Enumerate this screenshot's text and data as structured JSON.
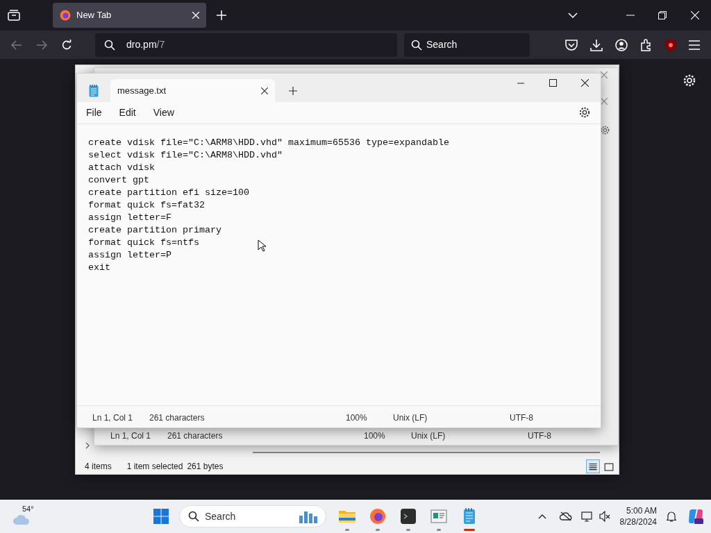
{
  "browser": {
    "tabs": [
      {
        "title": "New Tab",
        "selected": true
      }
    ],
    "address": {
      "host": "dro.pm",
      "path": "/7"
    },
    "search": {
      "placeholder": "Search"
    }
  },
  "explorer_window": {
    "status": {
      "items": "4 items",
      "selection": "1 item selected",
      "size": "261 bytes"
    },
    "view_buttons": [
      {
        "kind": "details",
        "selected": true
      },
      {
        "kind": "tiles",
        "selected": false
      }
    ]
  },
  "back_notepad": {
    "status": {
      "position": "Ln 1, Col 1",
      "characters": "261 characters",
      "zoom": "100%",
      "line_ending": "Unix (LF)",
      "encoding": "UTF-8"
    }
  },
  "notepad": {
    "tabs": [
      {
        "title": "message.txt",
        "selected": true
      }
    ],
    "menu": [
      "File",
      "Edit",
      "View"
    ],
    "lines": [
      "create vdisk file=\"C:\\ARM8\\HDD.vhd\" maximum=65536 type=expandable",
      "select vdisk file=\"C:\\ARM8\\HDD.vhd\"",
      "attach vdisk",
      "convert gpt",
      "create partition efi size=100",
      "format quick fs=fat32",
      "assign letter=F",
      "create partition primary",
      "format quick fs=ntfs",
      "assign letter=P",
      "exit"
    ],
    "status": {
      "position": "Ln 1, Col 1",
      "characters": "261 characters",
      "zoom": "100%",
      "line_ending": "Unix (LF)",
      "encoding": "UTF-8"
    }
  },
  "taskbar": {
    "weather": "54°",
    "search": {
      "placeholder": "Search"
    },
    "apps": [
      {
        "kind": "folder",
        "running": true,
        "selected": false
      },
      {
        "kind": "browser",
        "running": true,
        "selected": false
      },
      {
        "kind": "terminal",
        "running": true,
        "selected": false
      },
      {
        "kind": "window",
        "running": true,
        "selected": false
      },
      {
        "kind": "notepad",
        "running": true,
        "selected": true
      }
    ],
    "time": "5:00 AM",
    "date": "8/28/2024"
  }
}
